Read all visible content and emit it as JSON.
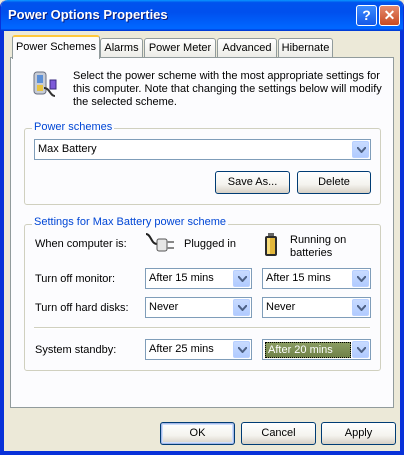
{
  "window": {
    "title": "Power Options Properties"
  },
  "title_buttons": {
    "help": "?",
    "close": "✕"
  },
  "tabs": [
    {
      "label": "Power Schemes",
      "active": true
    },
    {
      "label": "Alarms"
    },
    {
      "label": "Power Meter"
    },
    {
      "label": "Advanced"
    },
    {
      "label": "Hibernate"
    }
  ],
  "intro": {
    "icon": "power-scheme-icon",
    "text": "Select the power scheme with the most appropriate settings for this computer. Note that changing the settings below will modify the selected scheme."
  },
  "power_schemes": {
    "group_label": "Power schemes",
    "selected": "Max Battery",
    "save_as_label": "Save As...",
    "delete_label": "Delete"
  },
  "settings": {
    "group_label": "Settings for Max Battery power scheme",
    "when_label": "When computer is:",
    "plugged_in_label": "Plugged in",
    "batteries_label": "Running on batteries",
    "rows": [
      {
        "label": "Turn off monitor:",
        "plugged": "After 15 mins",
        "battery": "After 15 mins"
      },
      {
        "label": "Turn off hard disks:",
        "plugged": "Never",
        "battery": "Never"
      },
      {
        "label": "System standby:",
        "plugged": "After 25 mins",
        "battery": "After 20 mins"
      }
    ]
  },
  "footer": {
    "ok_label": "OK",
    "cancel_label": "Cancel",
    "apply_label": "Apply"
  },
  "colors": {
    "title_blue": "#0054e3",
    "group_label": "#0046d5",
    "tab_highlight": "#ffc83c"
  }
}
